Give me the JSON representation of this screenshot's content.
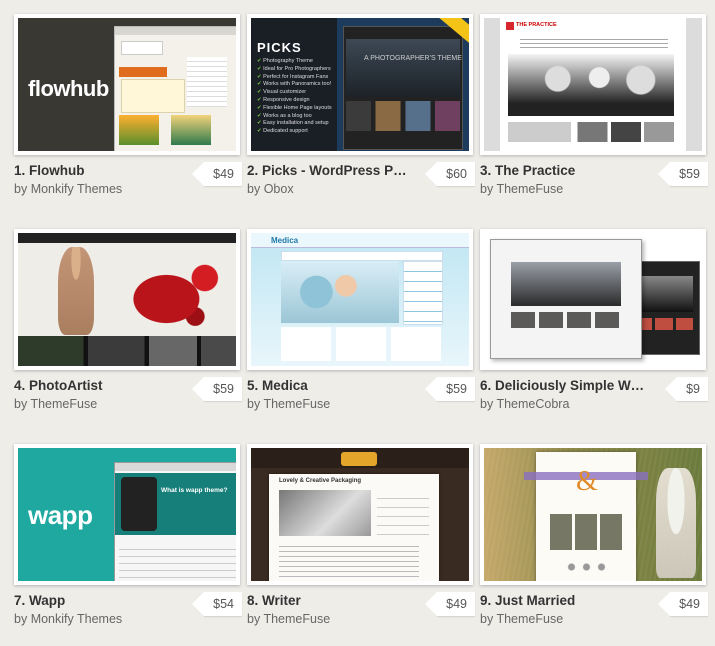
{
  "items": [
    {
      "title": "1. Flowhub",
      "by": "by",
      "author": "Monkify Themes",
      "price": "$49",
      "thumb_logo": "flowhub"
    },
    {
      "title": "2. Picks - WordPress Ph...",
      "by": "by",
      "author": "Obox",
      "price": "$60",
      "thumb_heading": "PICKS",
      "thumb_features": [
        "Photography Theme",
        "Ideal for Pro Photographers",
        "Perfect for Instagram Fans",
        "Works with Panoramics too!",
        "Visual customizer",
        "Responsive design",
        "Flexible Home Page layouts",
        "Works as a blog too",
        "Easy installation and setup",
        "Dedicated support"
      ],
      "thumb_caption": "A PHOTOGRAPHER'S THEME"
    },
    {
      "title": "3. The Practice",
      "by": "by",
      "author": "ThemeFuse",
      "price": "$59",
      "thumb_brand": "THE PRACTICE"
    },
    {
      "title": "4. PhotoArtist",
      "by": "by",
      "author": "ThemeFuse",
      "price": "$59"
    },
    {
      "title": "5. Medica",
      "by": "by",
      "author": "ThemeFuse",
      "price": "$59",
      "thumb_brand": "Medica"
    },
    {
      "title": "6. Deliciously Simple Wo...",
      "by": "by",
      "author": "ThemeCobra",
      "price": "$9"
    },
    {
      "title": "7. Wapp",
      "by": "by",
      "author": "Monkify Themes",
      "price": "$54",
      "thumb_logo": "wapp",
      "thumb_caption": "What is wapp theme?"
    },
    {
      "title": "8. Writer",
      "by": "by",
      "author": "ThemeFuse",
      "price": "$49",
      "thumb_caption": "Lovely & Creative Packaging"
    },
    {
      "title": "9. Just Married",
      "by": "by",
      "author": "ThemeFuse",
      "price": "$49",
      "thumb_glyph": "&"
    }
  ]
}
